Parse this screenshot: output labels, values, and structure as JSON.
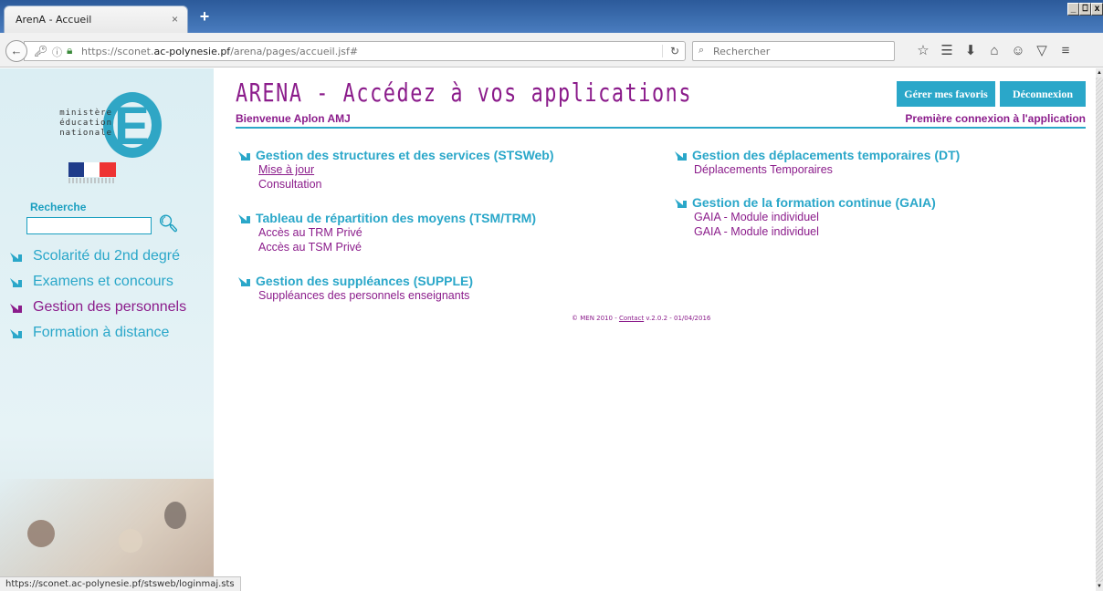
{
  "browser": {
    "tab_title": "ArenA - Accueil",
    "tab_close": "×",
    "new_tab": "+",
    "win_min": "_",
    "win_max": "⎕",
    "win_close": "x",
    "url_host": "https://sconet.",
    "url_domain": "ac-polynesie.pf",
    "url_path": "/arena/pages/accueil.jsf#",
    "search_placeholder": "Rechercher",
    "status_url": "https://sconet.ac-polynesie.pf/stsweb/loginmaj.sts"
  },
  "sidebar": {
    "logo_text": "ministère\néducation\nnationale",
    "search_label": "Recherche",
    "search_value": "",
    "menu": [
      {
        "label": "Scolarité du 2nd degré",
        "active": false
      },
      {
        "label": "Examens et concours",
        "active": false
      },
      {
        "label": "Gestion des personnels",
        "active": true
      },
      {
        "label": "Formation à distance",
        "active": false
      }
    ]
  },
  "header": {
    "title": "ARENA - Accédez à vos applications",
    "welcome": "Bienvenue Aplon AMJ",
    "first_connection": "Première connexion à l'application",
    "btn_favorites": "Gérer mes favoris",
    "btn_logout": "Déconnexion"
  },
  "sections": {
    "left": [
      {
        "title": "Gestion des structures et des services (STSWeb)",
        "links": [
          "Mise à jour",
          "Consultation"
        ]
      },
      {
        "title": "Tableau de répartition des moyens (TSM/TRM)",
        "links": [
          "Accès au TRM Privé",
          "Accès au TSM Privé"
        ]
      },
      {
        "title": "Gestion des suppléances (SUPPLE)",
        "links": [
          "Suppléances des personnels enseignants"
        ]
      }
    ],
    "right": [
      {
        "title": "Gestion des déplacements temporaires (DT)",
        "links": [
          "Déplacements Temporaires"
        ]
      },
      {
        "title": "Gestion de la formation continue (GAIA)",
        "links": [
          "GAIA - Module individuel",
          "GAIA - Module individuel"
        ]
      }
    ]
  },
  "footer": {
    "prefix": "© MEN 2010 - ",
    "contact": "Contact",
    "suffix": " v.2.0.2 - 01/04/2016"
  },
  "colors": {
    "accent_cyan": "#2aa7c9",
    "accent_purple": "#8b1c8b"
  }
}
